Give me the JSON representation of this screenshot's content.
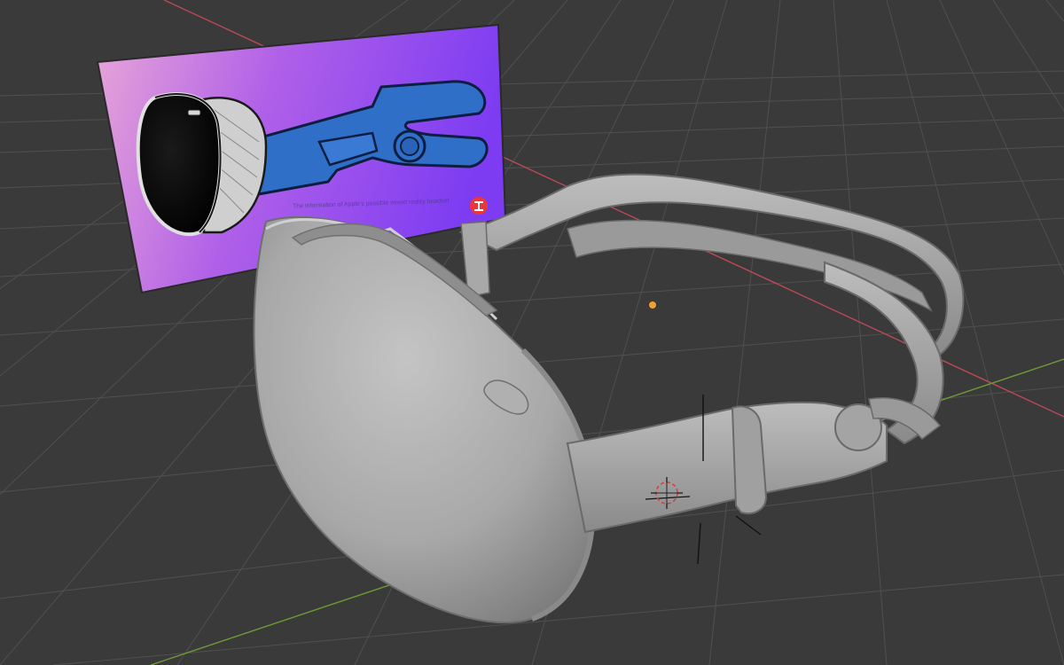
{
  "reference_caption": "The information of Apple's possible mixed reality headset",
  "colors": {
    "viewport_bg": "#3a3a3a",
    "grid_line": "#555555",
    "x_axis": "#c0505a",
    "y_axis": "#7aa43a",
    "reference_gradient_start": "#e8a0d8",
    "reference_gradient_end": "#8a3cf0",
    "model_fill": "#9c9c9c",
    "model_highlight": "#c8c8c8",
    "strap_blue": "#2f6fc8",
    "origin_dot": "#f0a030",
    "cursor_red": "#d04040"
  },
  "icons": {
    "reference_badge": "red-logo-icon",
    "origin": "origin-point-icon",
    "cursor": "3d-cursor-icon"
  }
}
